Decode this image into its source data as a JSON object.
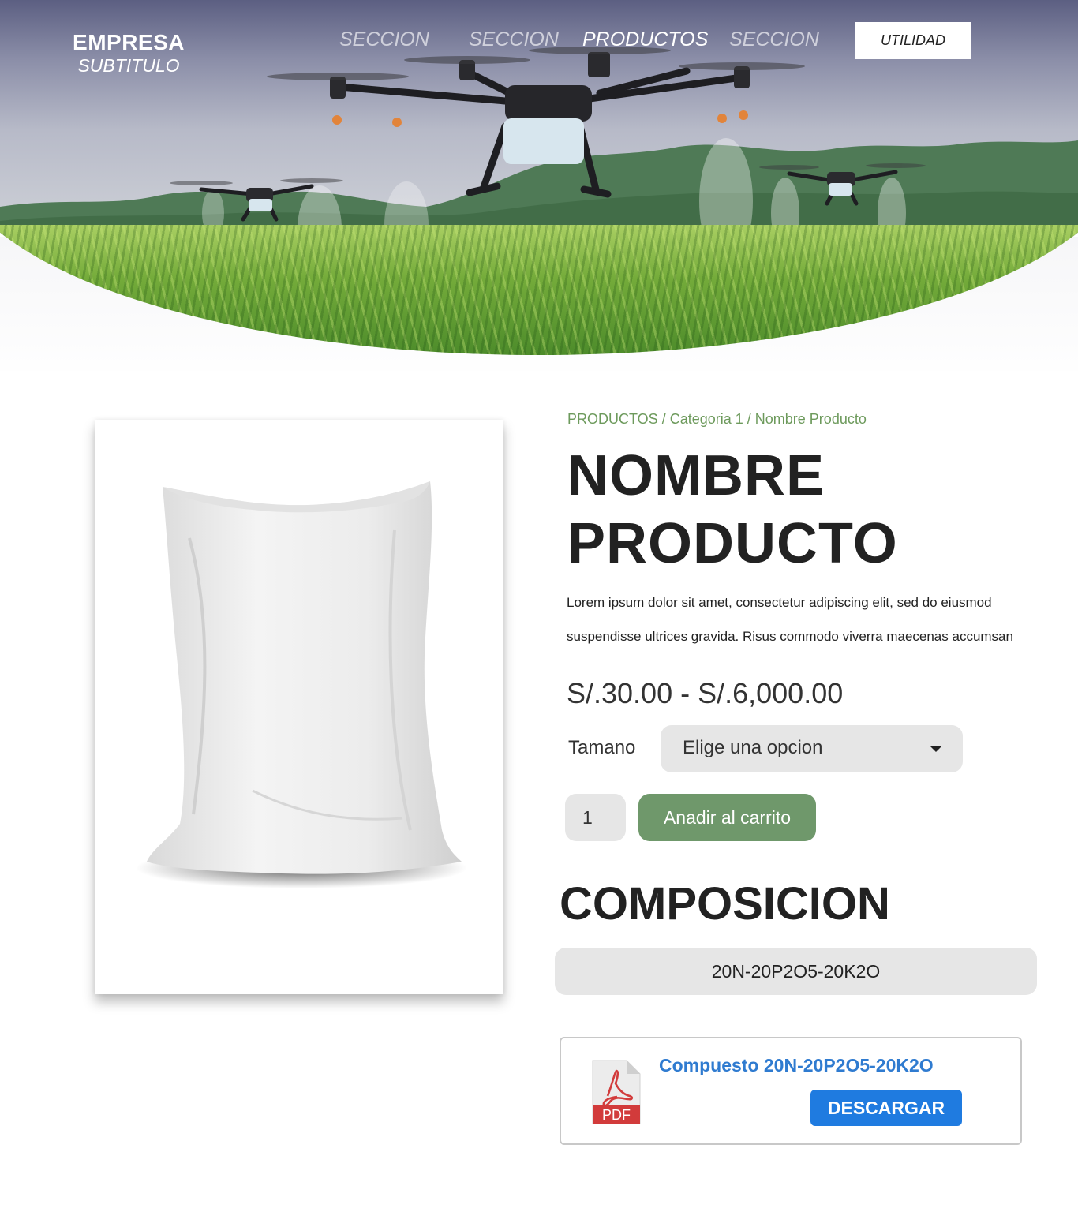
{
  "brand": {
    "name": "EMPRESA",
    "subtitle": "SUBTITULO"
  },
  "nav": {
    "items": [
      {
        "label": "SECCION",
        "active": false
      },
      {
        "label": "SECCION",
        "active": false
      },
      {
        "label": "PRODUCTOS",
        "active": true
      },
      {
        "label": "SECCION",
        "active": false
      }
    ],
    "utility_label": "UTILIDAD"
  },
  "breadcrumb": {
    "root": "PRODUCTOS",
    "category": "Categoria 1",
    "current": "Nombre Producto",
    "separator": " / "
  },
  "product": {
    "title_line1": "NOMBRE",
    "title_line2": "PRODUCTO",
    "description_line1": "Lorem ipsum dolor sit amet, consectetur adipiscing elit, sed do eiusmod",
    "description_line2": "suspendisse ultrices gravida. Risus commodo viverra maecenas accumsan",
    "price_range": "S/.30.00 - S/.6,000.00",
    "size_label": "Tamano",
    "size_placeholder": "Elige una opcion",
    "quantity": "1",
    "add_to_cart_label": "Anadir al carrito",
    "image_icon": "fertilizer-bag-image"
  },
  "composition": {
    "title": "COMPOSICION",
    "value": "20N-20P2O5-20K2O"
  },
  "download": {
    "file_type": "PDF",
    "file_name": "Compuesto 20N-20P2O5-20K2O",
    "button_label": "DESCARGAR",
    "icon": "pdf-file-icon"
  },
  "colors": {
    "accent_green": "#6f986b",
    "breadcrumb_green": "#6d9a5c",
    "download_blue": "#1f7be0",
    "link_blue": "#2f7bd0",
    "pdf_red": "#d23b3b"
  }
}
